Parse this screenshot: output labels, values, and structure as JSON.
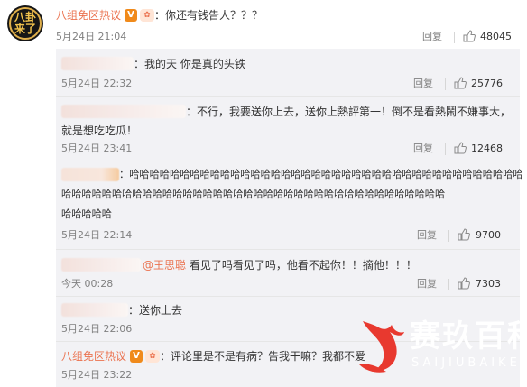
{
  "main_comment": {
    "avatar_text": [
      "八卦",
      "来了"
    ],
    "author": "八组免区热议",
    "badge_v": "V",
    "badge_star": "✿",
    "text": "：你还有钱告人？？？",
    "time": "5月24日 21:04",
    "reply_label": "回复",
    "likes": "48045"
  },
  "replies": [
    {
      "text": "：我的天 你是真的头铁",
      "time": "5月24日 22:32",
      "reply_label": "回复",
      "likes": "25776"
    },
    {
      "text_line1": "：不行，我要送你上去，送你上熱評第一！倒不是看熱鬧不嫌事大，",
      "text_line2": "就是想吃吃瓜！",
      "time": "5月24日 23:41",
      "reply_label": "回复",
      "likes": "12468"
    },
    {
      "text_line1": "：哈哈哈哈哈哈哈哈哈哈哈哈哈哈哈哈哈哈哈哈哈哈哈哈哈哈哈哈哈哈哈哈哈哈哈哈哈哈哈",
      "text_line2": "哈哈哈哈哈哈哈哈哈哈哈哈哈哈哈哈哈哈哈哈哈哈哈哈哈哈哈哈哈哈哈哈哈哈哈哈哈哈",
      "text_line3": "哈哈哈哈哈",
      "time": "5月24日 22:14",
      "reply_label": "回复",
      "likes": "9700"
    },
    {
      "mention": "@王思聪",
      "text": " 看见了吗看见了吗，他看不起你！！摘他！！！",
      "time": "今天 00:28",
      "reply_label": "回复",
      "likes": "7303"
    },
    {
      "text": "：送你上去",
      "time": "5月24日 22:06"
    },
    {
      "author": "八组免区热议",
      "badge_v": "V",
      "badge_star": "✿",
      "text": "：评论里是不是有病？告我干嘛？我都不爱",
      "time": "5月24日 23:22"
    }
  ],
  "watermark": {
    "cn": "赛玖百科",
    "en": "SAIJIUBAIKE"
  },
  "icons": [
    "thumb-up-icon",
    "watermark-logo-icon"
  ],
  "colors": {
    "accent": "#eb7350",
    "watermark_red": "#e8392f",
    "reply_bg": "#f2f2f5"
  }
}
